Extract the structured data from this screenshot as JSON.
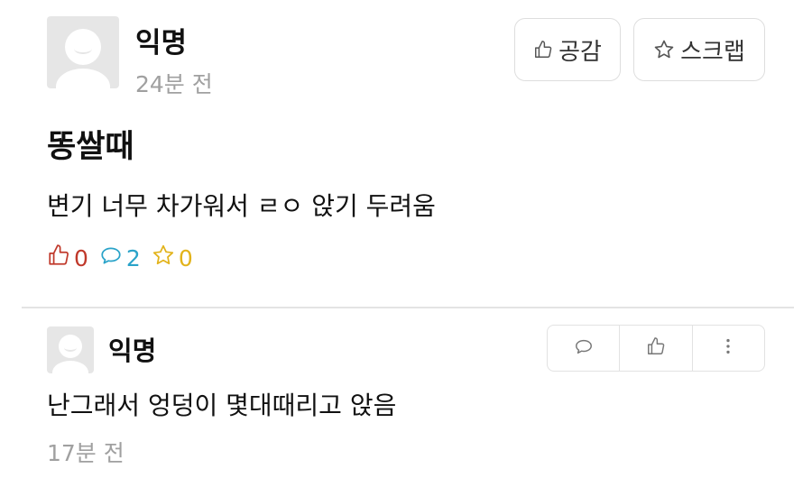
{
  "post": {
    "author": "익명",
    "time": "24분 전",
    "title": "똥쌀때",
    "body": "변기 너무 차가워서 ㄹㅇ 앉기 두려움",
    "like_label": "공감",
    "scrap_label": "스크랩",
    "counts": {
      "likes": "0",
      "comments": "2",
      "scraps": "0"
    }
  },
  "comment": {
    "author": "익명",
    "text": "난그래서 엉덩이 몇대때리고 앉음",
    "time": "17분 전"
  },
  "colors": {
    "like": "#c0392b",
    "comment": "#2aa3c9",
    "scrap": "#e2b31b",
    "border": "#dedede",
    "muted": "#a0a0a0"
  }
}
